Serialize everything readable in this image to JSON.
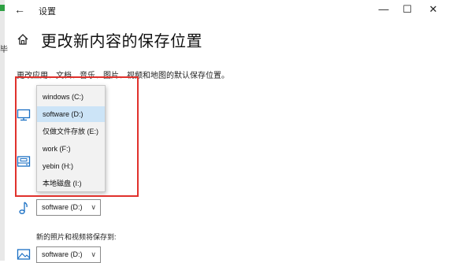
{
  "window": {
    "title": "设置",
    "back_glyph": "←",
    "minimize_glyph": "—",
    "maximize_glyph": "☐",
    "close_glyph": "✕"
  },
  "left_edge_char": "毕",
  "page": {
    "title": "更改新内容的保存位置",
    "description": "更改应用、文档、音乐、图片、视频和地图的默认保存位置。"
  },
  "dropdown": {
    "options": [
      "windows (C:)",
      "software (D:)",
      "仅做文件存放 (E:)",
      "work (F:)",
      "yebin (H:)",
      "本地磁盘 (I:)"
    ],
    "selected_index": 1
  },
  "rows": {
    "music": {
      "value": "software (D:)",
      "chevron": "∨"
    },
    "photos_label": "新的照片和视频将保存到:",
    "photos": {
      "value": "software (D:)",
      "chevron": "∨"
    }
  },
  "colors": {
    "highlight_border": "#e0312c",
    "selected_option": "#cce4f7",
    "icon_blue": "#1a6fc4"
  },
  "icons": [
    "back-arrow-icon",
    "home-icon",
    "monitor-icon",
    "drive-icon",
    "music-note-icon",
    "photo-icon"
  ]
}
